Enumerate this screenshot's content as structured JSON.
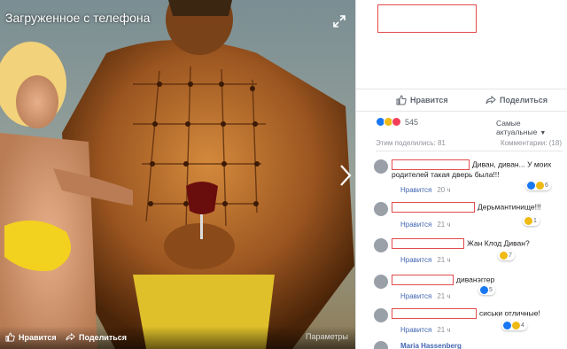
{
  "viewer": {
    "title": "Загруженное с телефона",
    "like_label": "Нравится",
    "share_label": "Поделиться",
    "options_label": "Параметры"
  },
  "panel": {
    "like_label": "Нравится",
    "share_label": "Поделиться",
    "reaction_count": "545",
    "sort_label": "Самые актуальные",
    "shares_label": "Этим поделились: 81",
    "comments_label": "Комментарии: (18)",
    "like_action": "Нравится"
  },
  "comments": [
    {
      "text": "Диван, диван... У моих родителей такая дверь была!!!",
      "time": "20 ч",
      "reactions": "6",
      "reaction_colors": [
        "#1877f2",
        "#f0ba15"
      ]
    },
    {
      "text": "Дерьмантинище!!!",
      "time": "21 ч",
      "reactions": "1",
      "reaction_colors": [
        "#f0ba15"
      ]
    },
    {
      "text": "Жан Клод Диван?",
      "time": "21 ч",
      "reactions": "7",
      "reaction_colors": [
        "#f0ba15"
      ]
    },
    {
      "text": "диванэггер",
      "time": "21 ч",
      "reactions": "5",
      "reaction_colors": [
        "#1877f2"
      ]
    },
    {
      "text": "сиськи отличные!",
      "time": "21 ч",
      "reactions": "4",
      "reaction_colors": [
        "#1877f2",
        "#f0ba15"
      ]
    }
  ],
  "last_comment_author": "Maria Hassenberg"
}
